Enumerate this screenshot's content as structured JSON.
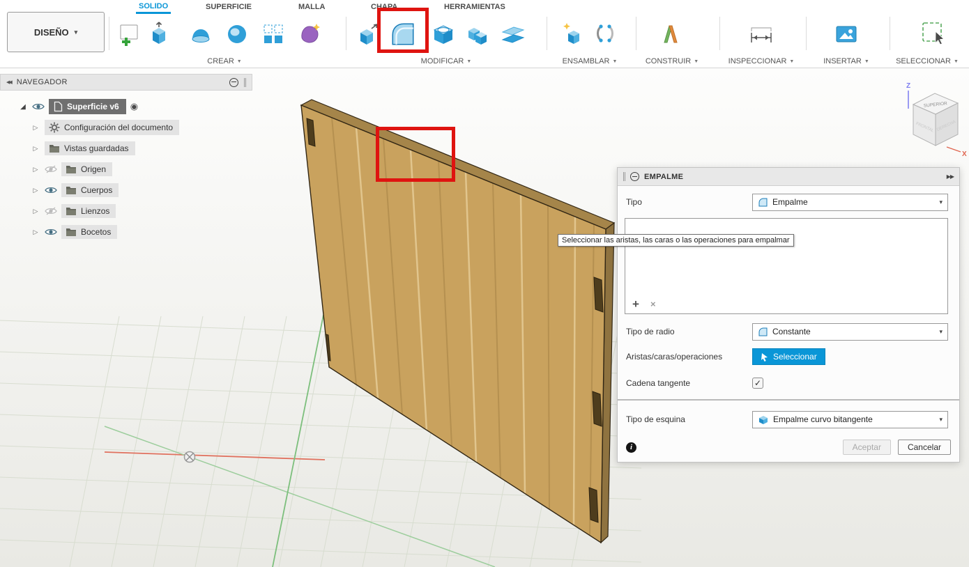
{
  "toolbar": {
    "design_dropdown": "DISEÑO",
    "tabs": [
      {
        "label": "SOLIDO",
        "active": true
      },
      {
        "label": "SUPERFICIE",
        "active": false
      },
      {
        "label": "MALLA",
        "active": false
      },
      {
        "label": "CHAPA",
        "active": false
      },
      {
        "label": "HERRAMIENTAS",
        "active": false
      }
    ],
    "groups": [
      {
        "label": "CREAR"
      },
      {
        "label": "MODIFICAR"
      },
      {
        "label": "ENSAMBLAR"
      },
      {
        "label": "CONSTRUIR"
      },
      {
        "label": "INSPECCIONAR"
      },
      {
        "label": "INSERTAR"
      },
      {
        "label": "SELECCIONAR"
      }
    ],
    "tools": {
      "crear": [
        "create-sketch",
        "extrude",
        "revolve",
        "sweep",
        "pattern",
        "form"
      ],
      "modificar": [
        "press-pull",
        "fillet",
        "shell",
        "combine",
        "split"
      ],
      "ensamblar": [
        "new-component",
        "joint"
      ],
      "construir": [
        "construction-plane"
      ],
      "inspeccionar": [
        "measure"
      ],
      "insertar": [
        "insert-image"
      ],
      "seleccionar": [
        "select"
      ]
    },
    "highlight_color": "#df1410"
  },
  "navigator": {
    "title": "NAVEGADOR",
    "root": {
      "label": "Superficie v6"
    },
    "items": [
      {
        "label": "Configuración del documento",
        "icon": "gear",
        "visibility": "none"
      },
      {
        "label": "Vistas guardadas",
        "icon": "folder",
        "visibility": "none"
      },
      {
        "label": "Origen",
        "icon": "folder",
        "visibility": "hidden"
      },
      {
        "label": "Cuerpos",
        "icon": "folder",
        "visibility": "visible"
      },
      {
        "label": "Lienzos",
        "icon": "folder",
        "visibility": "hidden"
      },
      {
        "label": "Bocetos",
        "icon": "folder",
        "visibility": "visible"
      }
    ]
  },
  "dialog": {
    "title": "EMPALME",
    "tipo_label": "Tipo",
    "tipo_value": "Empalme",
    "tooltip": "Seleccionar las aristas, las caras o las operaciones para empalmar",
    "radio_label": "Tipo de radio",
    "radio_value": "Constante",
    "edges_label": "Aristas/caras/operaciones",
    "select_button": "Seleccionar",
    "chain_label": "Cadena tangente",
    "chain_checked": true,
    "corner_label": "Tipo de esquina",
    "corner_value": "Empalme curvo bitangente",
    "accept": "Aceptar",
    "cancel": "Cancelar",
    "accept_enabled": false,
    "accent_color": "#0a96d7"
  },
  "viewcube": {
    "top": "SUPERIOR",
    "front": "FRONTAL",
    "right": "DERECHA",
    "axis_z": "Z",
    "axis_x": "X"
  },
  "icons": {
    "caret_down": "▼",
    "caret_small": "▾",
    "collapse_left": "◀◀",
    "expand_right": "▶▶",
    "plus": "+",
    "cross": "×",
    "info": "i",
    "check": "✓",
    "expanded_tri": "◢",
    "collapsed_tri": "▷",
    "target": "◉"
  }
}
